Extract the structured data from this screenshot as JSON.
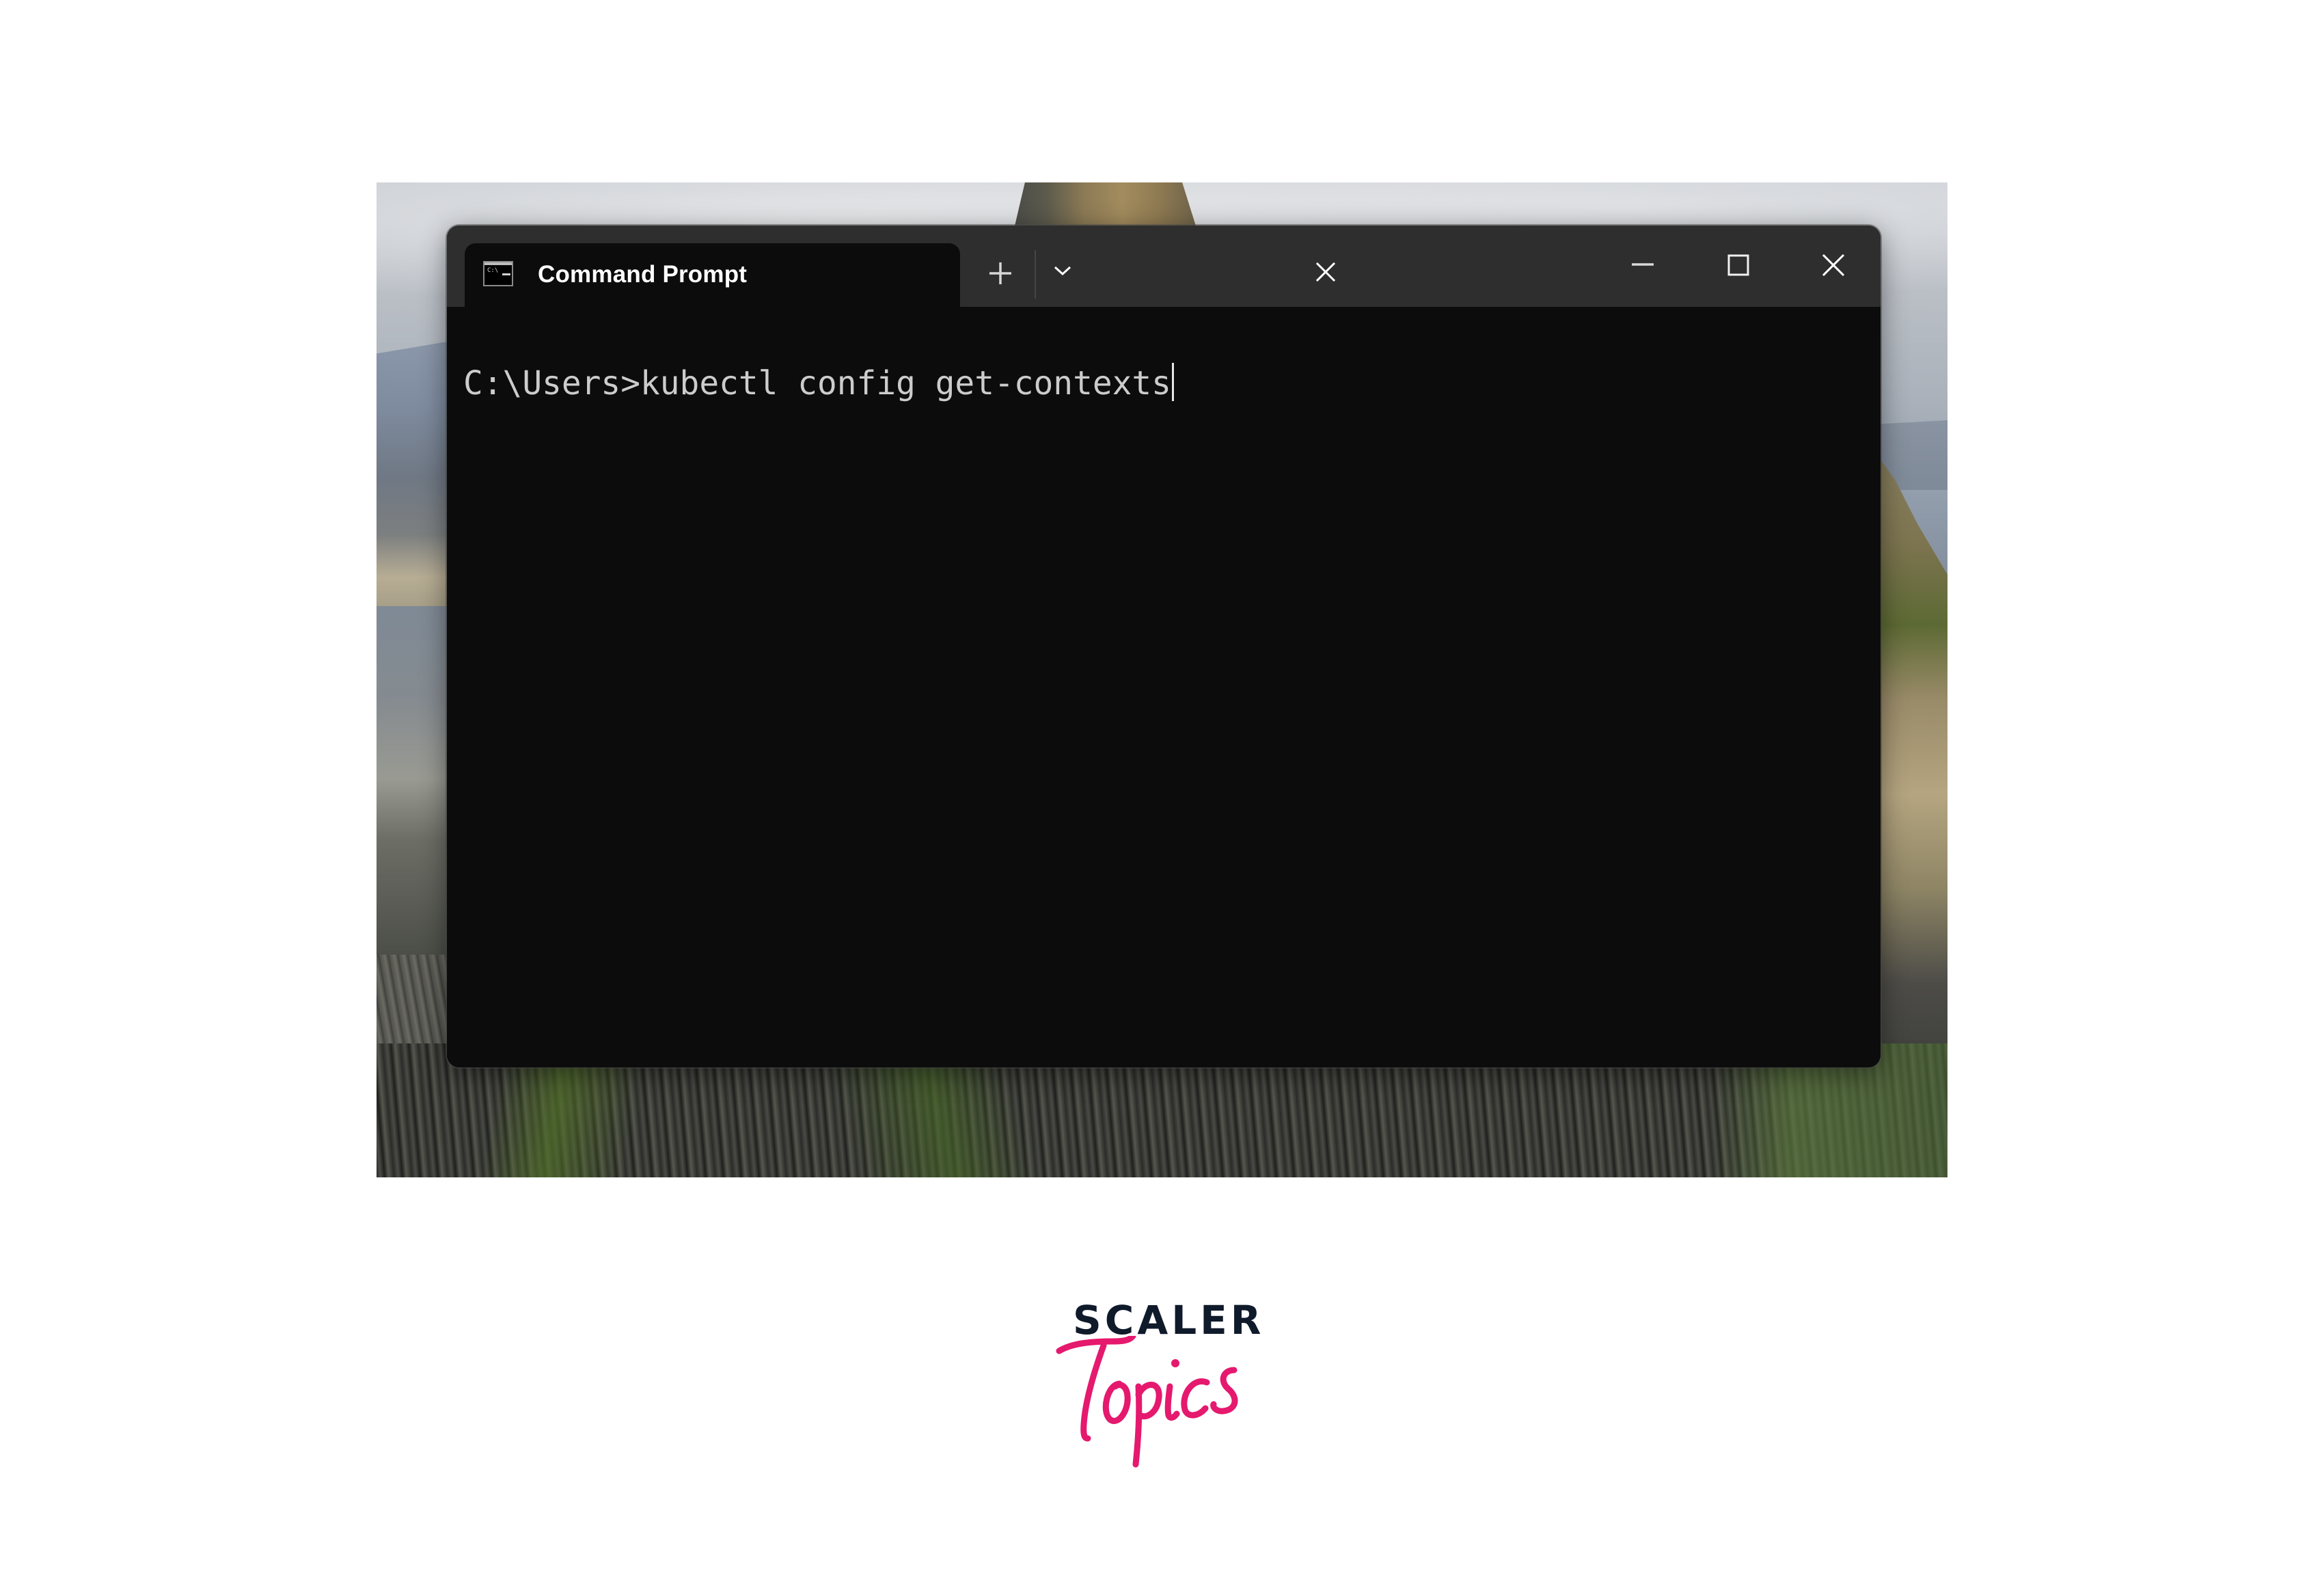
{
  "window": {
    "tab": {
      "title": "Command Prompt",
      "icon": "cmd-icon",
      "icon_text": "C:\\",
      "close_icon": "close-icon"
    },
    "tabbar": {
      "new_tab_icon": "plus-icon",
      "dropdown_icon": "chevron-down-icon"
    },
    "controls": {
      "minimize_icon": "minimize-icon",
      "maximize_icon": "maximize-icon",
      "close_icon": "close-icon"
    },
    "console": {
      "prompt": "C:\\Users>",
      "command": "kubectl config get-contexts"
    }
  },
  "logo": {
    "brand": "SCALER",
    "subbrand": "Topics",
    "colors": {
      "brand": "#0f1a2b",
      "subbrand": "#e5196e"
    }
  },
  "colors": {
    "titlebar": "#2e2e2e",
    "console_bg": "#0c0c0c",
    "console_text": "#cccccc"
  }
}
